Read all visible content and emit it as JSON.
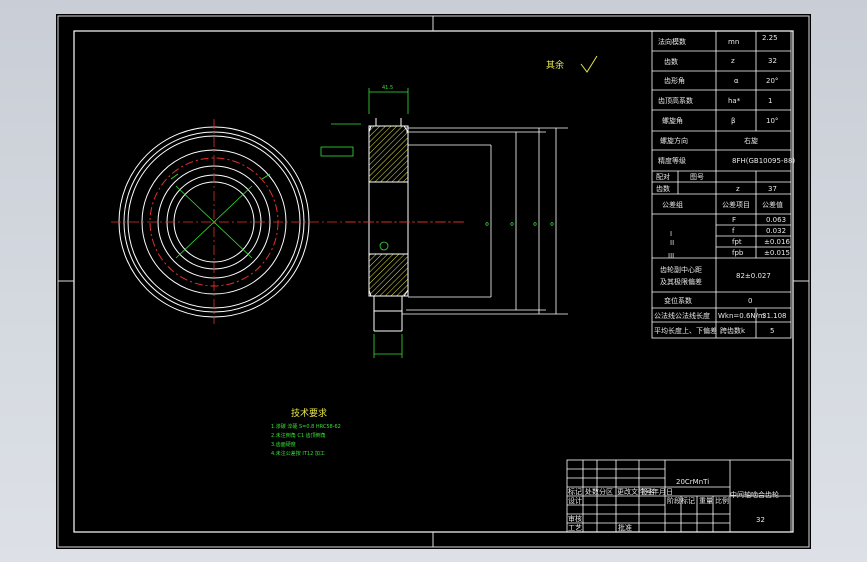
{
  "drawing": {
    "background": "#000000",
    "line_color": "#ffffff",
    "surface_note": "其余",
    "technical": {
      "title": "技术要求",
      "lines": [
        "1.渗碳 淬硬 S=0.8 HRC58-62",
        "2.未注倒角 C1 齿顶倒角",
        "3.齿面硬度",
        "4.未注公差按 IT12 加工"
      ]
    },
    "dims": {
      "top_width": "41.5",
      "od": "Φ",
      "inner_d": "Φ",
      "d1": "Φ",
      "d2": "Φ"
    }
  },
  "params": {
    "rows": [
      [
        "法向模数",
        "mn",
        "2.25"
      ],
      [
        "齿数",
        "z",
        "32"
      ],
      [
        "齿形角",
        "α",
        "20°"
      ],
      [
        "齿顶高系数",
        "ha*",
        "1"
      ],
      [
        "螺旋角",
        "β",
        "10°"
      ],
      [
        "螺旋方向",
        "右旋",
        ""
      ],
      [
        "精度等级",
        "8FH(GB10095-88)",
        ""
      ]
    ],
    "pair_row": [
      "配对",
      "图号",
      "",
      "齿数",
      "z",
      "37"
    ],
    "group_header": [
      "公差组",
      "公差项目",
      "公差值"
    ],
    "groups": [
      [
        "I",
        "F",
        "0.063"
      ],
      [
        "",
        "f",
        "0.032"
      ],
      [
        "II",
        "fpt",
        "±0.016"
      ],
      [
        "",
        "fpb",
        "±0.015"
      ],
      [
        "III",
        "Fβ",
        "0.018"
      ]
    ],
    "center": [
      "齿轮副中心距",
      "及其极限偏差",
      "82±0.027"
    ],
    "hidden": [
      "变位系数",
      "0"
    ],
    "span1": [
      "公法线公法线长度",
      "Wkn=0.6N/m",
      "31.108"
    ],
    "span2": [
      "平均长度上、下偏差",
      "跨齿数k",
      "5"
    ]
  },
  "titleblock": {
    "material": "20CrMnTi",
    "name": "中间轴啮合齿轮",
    "code": "32",
    "labels": [
      "标记",
      "处数",
      "分区",
      "更改文件号",
      "签名",
      "年月日"
    ],
    "labels2": [
      "设计",
      "审核",
      "工艺",
      "批准"
    ],
    "stage": [
      "阶段标记",
      "重量",
      "比例"
    ]
  }
}
